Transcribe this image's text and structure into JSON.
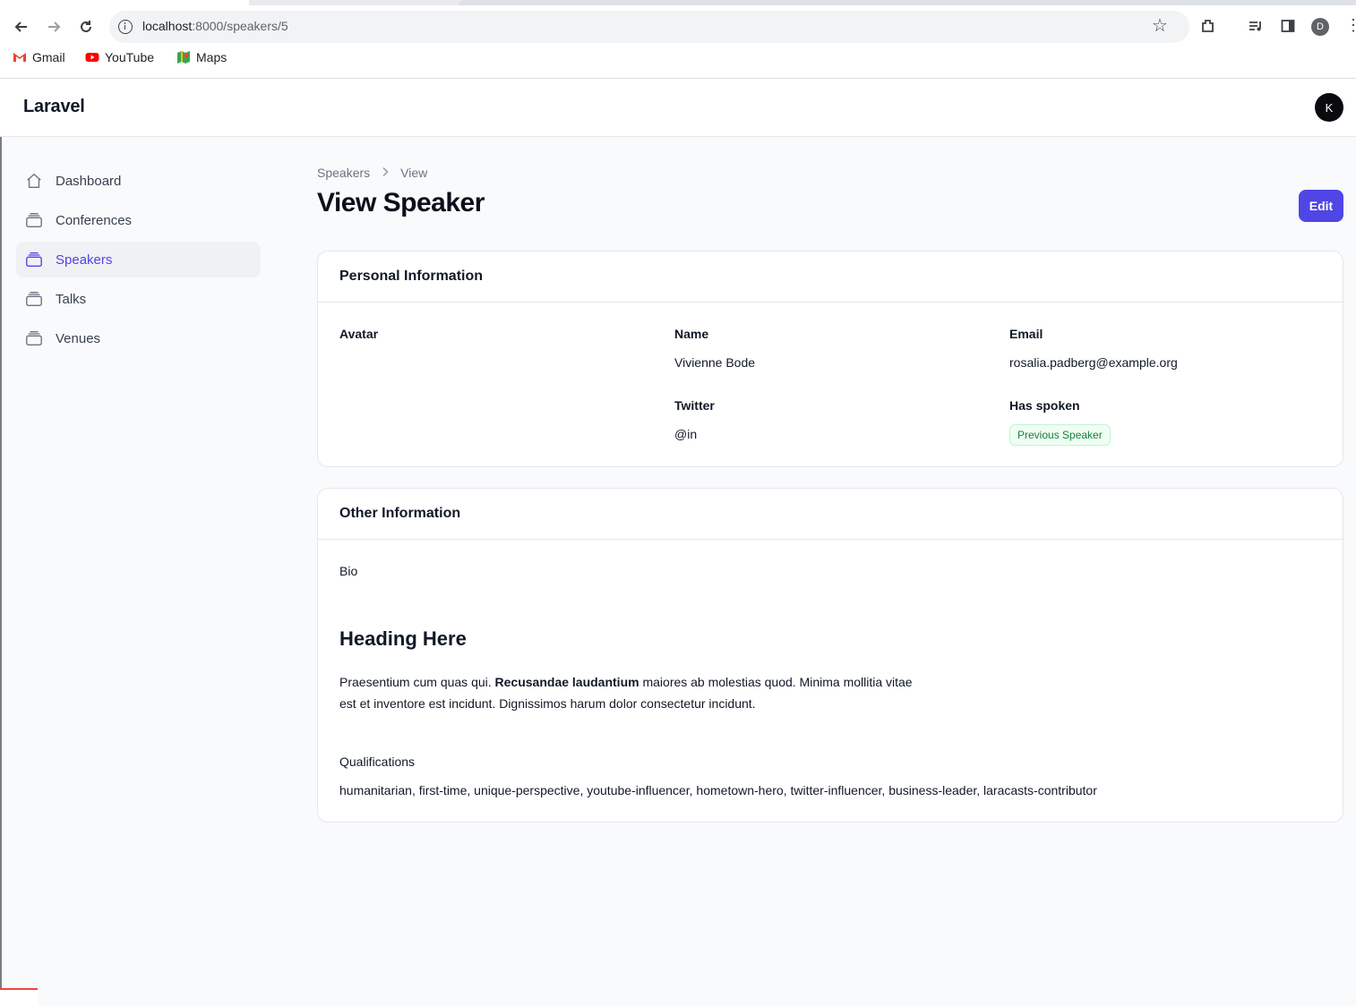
{
  "browser": {
    "url_host": "localhost",
    "url_path": ":8000/speakers/5",
    "profile_initial": "D",
    "bookmarks": [
      {
        "label": "Gmail",
        "icon": "gmail-icon"
      },
      {
        "label": "YouTube",
        "icon": "youtube-icon"
      },
      {
        "label": "Maps",
        "icon": "maps-icon"
      }
    ]
  },
  "app": {
    "brand": "Laravel",
    "user_initial": "K",
    "accent_color": "#4f46e5"
  },
  "sidebar": {
    "items": [
      {
        "label": "Dashboard",
        "icon": "home-icon",
        "active": false
      },
      {
        "label": "Conferences",
        "icon": "rectangle-stack-icon",
        "active": false
      },
      {
        "label": "Speakers",
        "icon": "rectangle-stack-icon",
        "active": true
      },
      {
        "label": "Talks",
        "icon": "rectangle-stack-icon",
        "active": false
      },
      {
        "label": "Venues",
        "icon": "rectangle-stack-icon",
        "active": false
      }
    ]
  },
  "breadcrumb": {
    "parent": "Speakers",
    "current": "View"
  },
  "page": {
    "title": "View Speaker",
    "edit_label": "Edit"
  },
  "personal": {
    "section_title": "Personal Information",
    "avatar_label": "Avatar",
    "name_label": "Name",
    "name_value": "Vivienne Bode",
    "email_label": "Email",
    "email_value": "rosalia.padberg@example.org",
    "twitter_label": "Twitter",
    "twitter_value": "@in",
    "has_spoken_label": "Has spoken",
    "has_spoken_badge": "Previous Speaker"
  },
  "other": {
    "section_title": "Other Information",
    "bio_label": "Bio",
    "bio_heading": "Heading Here",
    "bio_text_before": "Praesentium cum quas qui. ",
    "bio_text_bold": "Recusandae laudantium",
    "bio_text_after": " maiores ab molestias quod. Minima mollitia vitae est et inventore est incidunt. Dignissimos harum dolor consectetur incidunt.",
    "qualifications_label": "Qualifications",
    "qualifications_value": "humanitarian, first-time, unique-perspective, youtube-influencer, hometown-hero, twitter-influencer, business-leader, laracasts-contributor"
  }
}
